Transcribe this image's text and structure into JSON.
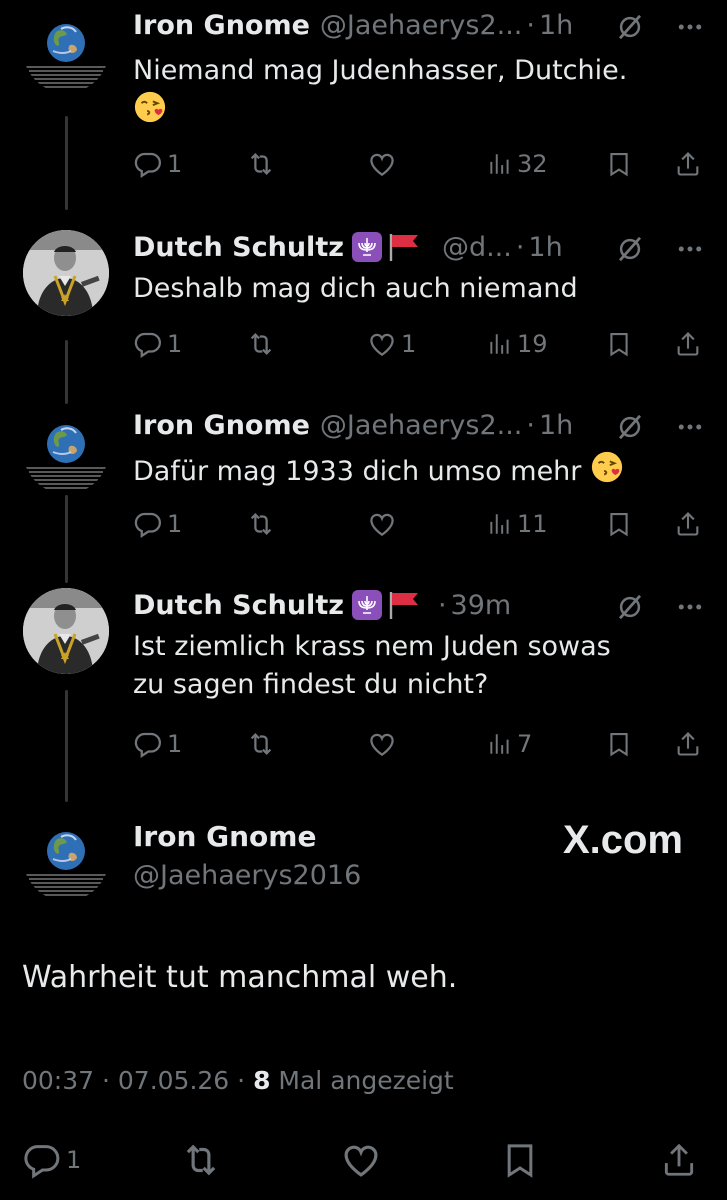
{
  "tweets": [
    {
      "name": "Iron Gnome",
      "handle": "@Jaehaerys2...",
      "time": "1h",
      "text": "Niemand mag Judenhasser, Dutchie.",
      "replies": "1",
      "likes": "",
      "views": "32"
    },
    {
      "name": "Dutch Schultz",
      "handle": "@d...",
      "time": "1h",
      "text": "Deshalb mag dich auch niemand",
      "replies": "1",
      "likes": "1",
      "views": "19"
    },
    {
      "name": "Iron Gnome",
      "handle": "@Jaehaerys2...",
      "time": "1h",
      "text": "Dafür mag 1933 dich umso mehr",
      "replies": "1",
      "likes": "",
      "views": "11"
    },
    {
      "name": "Dutch Schultz",
      "handle": "",
      "time": "39m",
      "text_line1": "Ist ziemlich krass nem Juden sowas",
      "text_line2": "zu sagen findest du nicht?",
      "replies": "1",
      "likes": "",
      "views": "7"
    }
  ],
  "main_tweet": {
    "name": "Iron Gnome",
    "handle": "@Jaehaerys2016",
    "watermark": "X.com",
    "text": "Wahrheit tut manchmal weh.",
    "time": "00:37 · 07.05.26 · ",
    "views_count": "8",
    "views_label": " Mal angezeigt",
    "replies": "1"
  },
  "dot": "·",
  "icons": [
    "reply-icon",
    "retweet-icon",
    "like-icon",
    "views-icon",
    "bookmark-icon",
    "share-icon",
    "grok-icon",
    "more-icon",
    "menorah-icon",
    "red-flag-icon",
    "kiss-emoji"
  ]
}
